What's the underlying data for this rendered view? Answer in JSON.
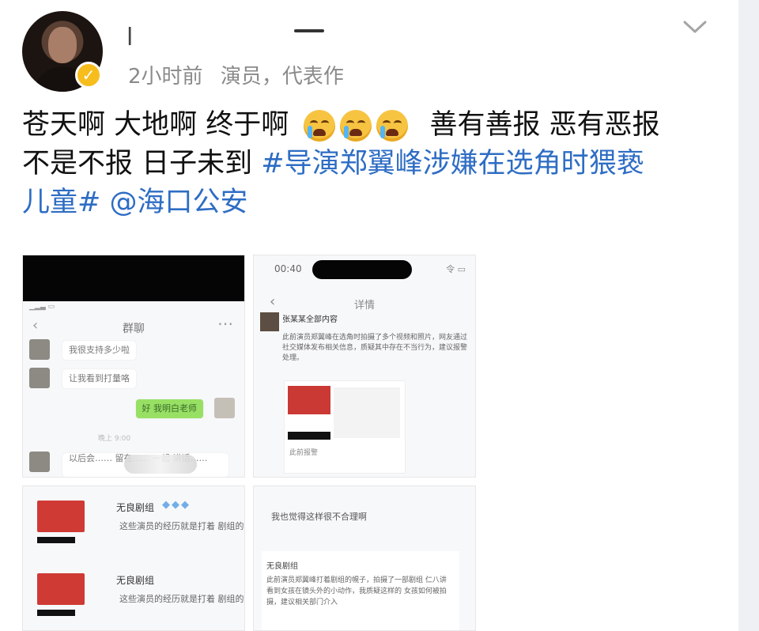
{
  "post": {
    "username": "l",
    "meta": {
      "time": "2小时前",
      "description": "演员，代表作"
    },
    "content": {
      "line1_before": "苍天啊 大地啊 终于啊",
      "line1_after": "善有善报 恶有恶报",
      "line2_before": "不是不报 日子未到",
      "hashtag_part1": "#导演郑翼峰涉嫌在选角时猥亵",
      "hashtag_part2": "儿童#",
      "mention": "@海口公安"
    },
    "emoji_names": [
      "crying-face-icon",
      "crying-face-icon",
      "crying-face-icon"
    ]
  },
  "screenshots": {
    "shot1": {
      "title": "群聊",
      "messages": [
        "我很支持多少啦",
        "让我看到打量咯",
        "好 我明白老师",
        "以后会…… 留在…… 一起 讲话……"
      ],
      "time_chip": "晚上 9:00"
    },
    "shot2": {
      "time": "00:40",
      "status": "令 ▭",
      "title": "详情",
      "name": "张某某全部内容",
      "text": "此前演员郑翼峰在选角时拍摄了多个视频和照片，网友通过社交媒体发布相关信息，质疑其中存在不当行为，建议报警处理。",
      "thumb_text": "此前报警"
    },
    "shot3": {
      "items": [
        {
          "title": "无良剧组",
          "text": "这些演员的经历就是打着\n剧组的幌子  找事闹"
        },
        {
          "title": "无良剧组",
          "text": "这些演员的经历就是打着\n剧组的幌子  找事闹"
        }
      ],
      "gems": "◆◆◆"
    },
    "shot4": {
      "quote": "我也觉得这样很不合理啊",
      "author": "无良剧组",
      "text": "此前演员郑翼峰打着剧组的幌子，拍摄了一部剧组 仁八讲 看到女孩在镜头外的小动作，我质疑这样的 女孩如何被拍摄，建议相关部门介入"
    }
  },
  "colors": {
    "link": "#2e6dc4",
    "badge": "#f6bd1d",
    "chat_green": "#98e064",
    "red_card": "#cf3a34"
  }
}
